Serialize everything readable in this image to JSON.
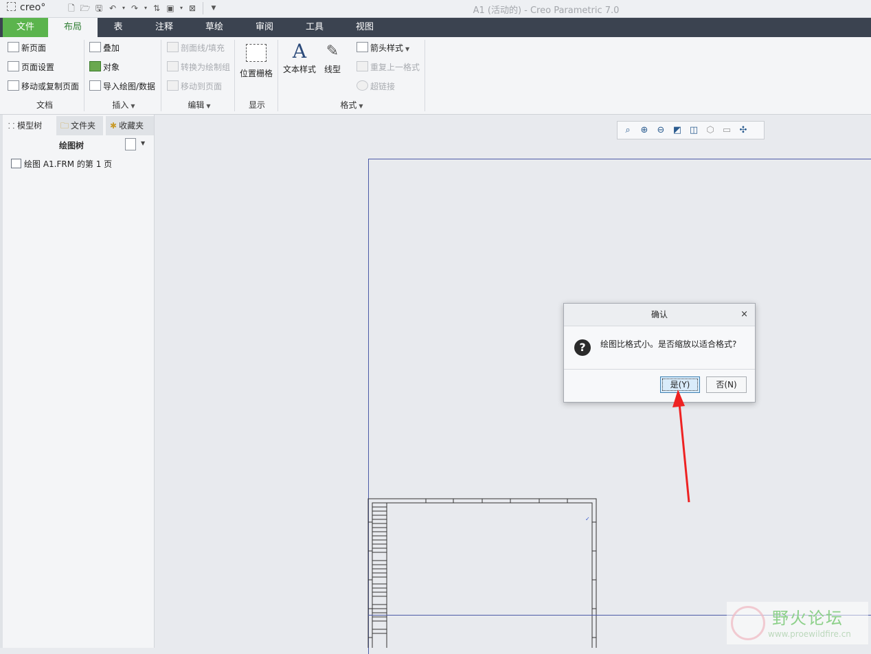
{
  "titlebar": {
    "logo": "creo",
    "window_title": "A1 (活动的) - Creo Parametric 7.0",
    "quick_access": [
      "new-icon",
      "open-icon",
      "save-icon",
      "undo-icon",
      "redo-icon",
      "regenerate-icon",
      "windows-icon",
      "close-window-icon",
      "customize-icon"
    ]
  },
  "menu": {
    "tabs": [
      "文件",
      "布局",
      "表",
      "注释",
      "草绘",
      "审阅",
      "工具",
      "视图"
    ],
    "active": "布局"
  },
  "ribbon": {
    "document": {
      "items": [
        "新页面",
        "页面设置",
        "移动或复制页面"
      ],
      "label": "文档"
    },
    "insert": {
      "items": [
        "叠加",
        "对象",
        "导入绘图/数据"
      ],
      "label": "插入"
    },
    "edit": {
      "items": [
        "剖面线/填充",
        "转换为绘制组",
        "移动到页面"
      ],
      "label": "编辑"
    },
    "display": {
      "items": [
        "位置栅格"
      ],
      "label": "显示"
    },
    "format": {
      "items": [
        "文本样式",
        "线型",
        "箭头样式",
        "重复上一格式",
        "超链接"
      ],
      "label": "格式"
    }
  },
  "leftpanel": {
    "tabs": [
      "模型树",
      "文件夹",
      "收藏夹"
    ],
    "tree_header": "绘图树",
    "tree_item": "绘图 A1.FRM 的第 1 页"
  },
  "dialog": {
    "title": "确认",
    "message": "绘图比格式小。是否缩放以适合格式?",
    "yes_label": "是(Y)",
    "no_label": "否(N)",
    "close": "×"
  },
  "watermark": {
    "title": "野火论坛",
    "url": "www.proewildfire.cn"
  }
}
